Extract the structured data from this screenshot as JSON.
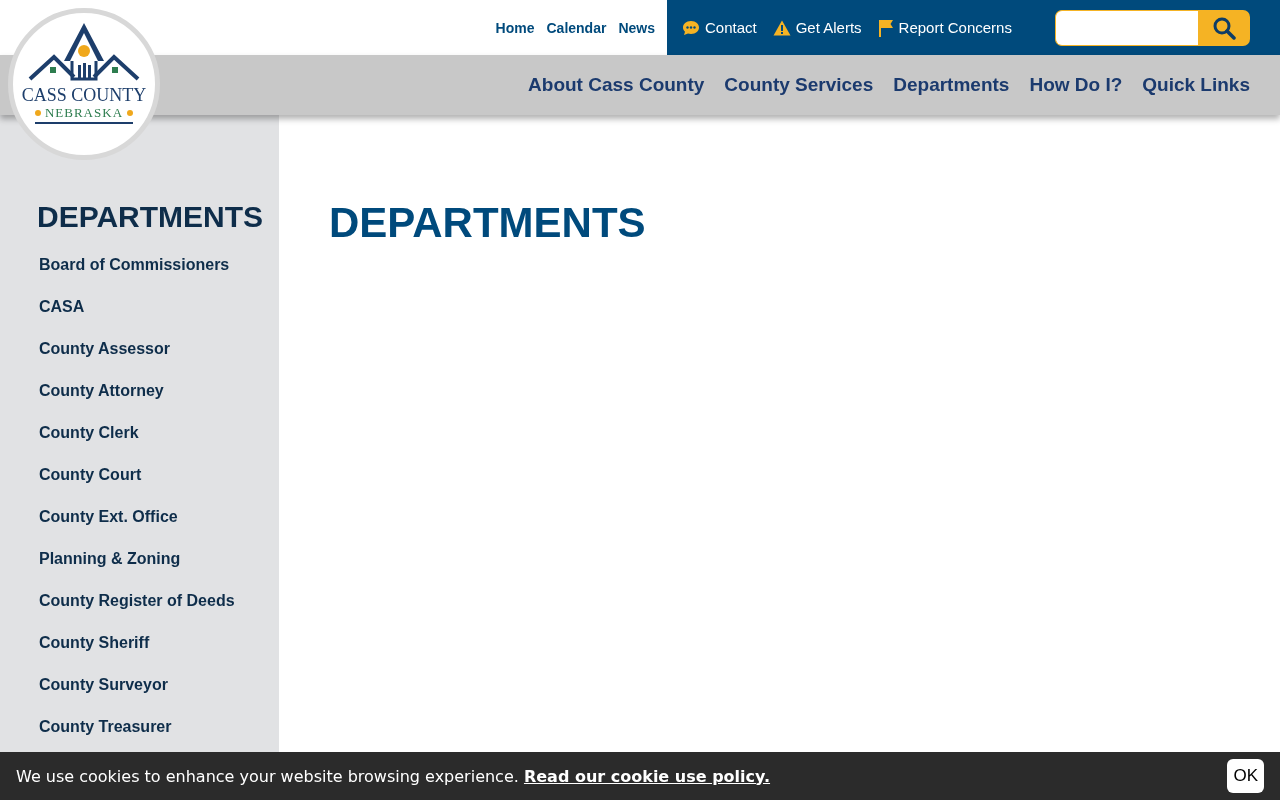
{
  "logo": {
    "title": "CASS COUNTY",
    "subtitle": "NEBRASKA"
  },
  "utility_links": [
    "Home",
    "Calendar",
    "News"
  ],
  "action_links": [
    {
      "kind": "contact",
      "label": "Contact"
    },
    {
      "kind": "alert",
      "label": "Get Alerts"
    },
    {
      "kind": "flag",
      "label": "Report Concerns"
    }
  ],
  "main_nav": [
    "About Cass County",
    "County Services",
    "Departments",
    "How Do I?",
    "Quick Links"
  ],
  "sidebar": {
    "title": "DEPARTMENTS",
    "items": [
      "Board of Commissioners",
      "CASA",
      "County Assessor",
      "County Attorney",
      "County Clerk",
      "County Court",
      "County Ext. Office",
      "Planning & Zoning",
      "County Register of Deeds",
      "County Sheriff",
      "County Surveyor",
      "County Treasurer"
    ]
  },
  "page_title": "DEPARTMENTS",
  "cookie_banner": {
    "message": "We use cookies to enhance your website browsing experience.",
    "link": "Read our cookie use policy.",
    "button": "OK"
  }
}
